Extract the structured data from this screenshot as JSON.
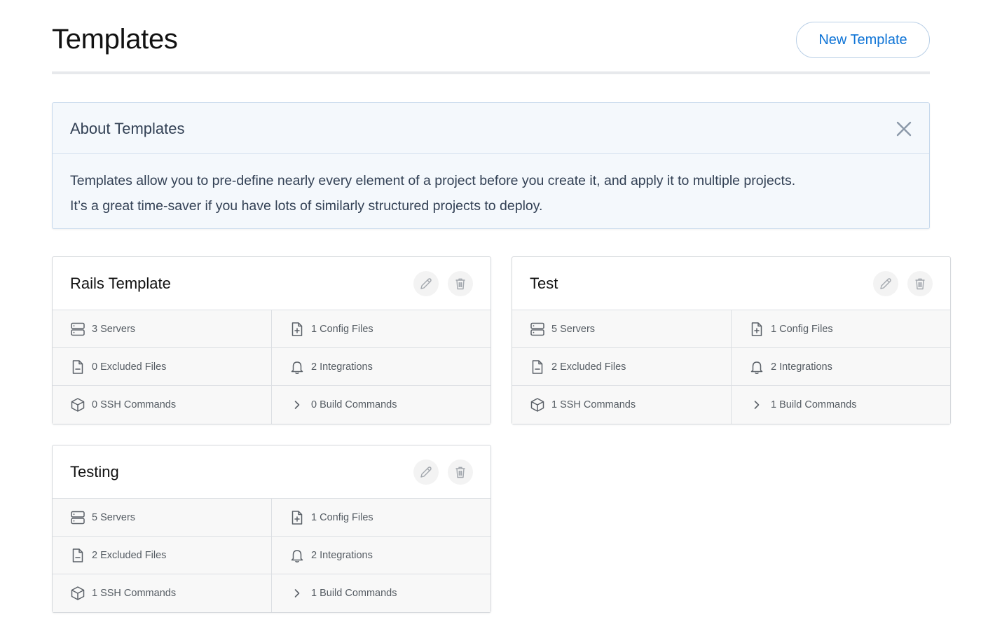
{
  "header": {
    "title": "Templates",
    "new_button_label": "New Template"
  },
  "about": {
    "title": "About Templates",
    "line1": "Templates allow you to pre-define nearly every element of a project before you create it, and apply it to multiple projects.",
    "line2": "It’s a great time-saver if you have lots of similarly structured projects to deploy."
  },
  "templates": [
    {
      "name": "Rails Template",
      "servers": "3 Servers",
      "config_files": "1 Config Files",
      "excluded_files": "0 Excluded Files",
      "integrations": "2 Integrations",
      "ssh_commands": "0 SSH Commands",
      "build_commands": "0 Build Commands"
    },
    {
      "name": "Test",
      "servers": "5 Servers",
      "config_files": "1 Config Files",
      "excluded_files": "2 Excluded Files",
      "integrations": "2 Integrations",
      "ssh_commands": "1 SSH Commands",
      "build_commands": "1 Build Commands"
    },
    {
      "name": "Testing",
      "servers": "5 Servers",
      "config_files": "1 Config Files",
      "excluded_files": "2 Excluded Files",
      "integrations": "2 Integrations",
      "ssh_commands": "1 SSH Commands",
      "build_commands": "1 Build Commands"
    }
  ],
  "icons": {
    "servers": "server-icon",
    "config_files": "file-plus-icon",
    "excluded_files": "file-minus-icon",
    "integrations": "bell-icon",
    "ssh_commands": "box-icon",
    "build_commands": "chevron-right-icon",
    "edit": "pencil-icon",
    "delete": "trash-icon",
    "close": "close-icon"
  },
  "colors": {
    "accent": "#0f74d6",
    "about_bg": "#f4f8fc",
    "about_border": "#c7d9ec",
    "cell_bg": "#f8f8f8"
  }
}
